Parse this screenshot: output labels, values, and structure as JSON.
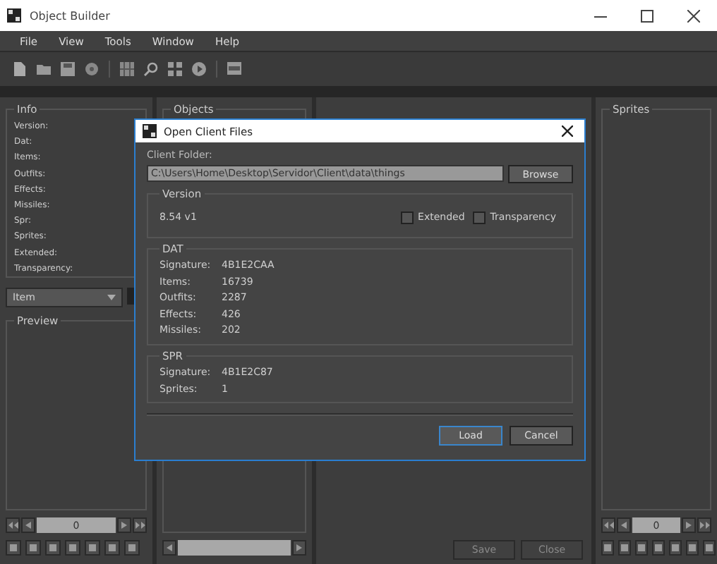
{
  "window": {
    "title": "Object Builder"
  },
  "menu": [
    "File",
    "View",
    "Tools",
    "Window",
    "Help"
  ],
  "info": {
    "title": "Info",
    "fields": [
      "Version:",
      "Dat:",
      "Items:",
      "Outfits:",
      "Effects:",
      "Missiles:",
      "Spr:",
      "Sprites:",
      "Extended:",
      "Transparency:"
    ]
  },
  "category": {
    "value": "Item"
  },
  "preview": {
    "title": "Preview",
    "frame": "0"
  },
  "objects": {
    "title": "Objects"
  },
  "center_buttons": [
    {
      "label": "Save",
      "disabled": true
    },
    {
      "label": "Close",
      "disabled": true
    }
  ],
  "sprites": {
    "title": "Sprites",
    "frame": "0"
  },
  "dialog": {
    "title": "Open Client Files",
    "folder_label": "Client Folder:",
    "folder": "C:\\Users\\Home\\Desktop\\Servidor\\Client\\data\\things",
    "browse": "Browse",
    "version": {
      "title": "Version",
      "value": "8.54 v1",
      "options": [
        {
          "label": "Extended",
          "checked": false
        },
        {
          "label": "Transparency",
          "checked": false
        }
      ]
    },
    "dat": {
      "title": "DAT",
      "rows": [
        {
          "label": "Signature:",
          "value": "4B1E2CAA"
        },
        {
          "label": "Items:",
          "value": "16739"
        },
        {
          "label": "Outfits:",
          "value": "2287"
        },
        {
          "label": "Effects:",
          "value": "426"
        },
        {
          "label": "Missiles:",
          "value": "202"
        }
      ]
    },
    "spr": {
      "title": "SPR",
      "rows": [
        {
          "label": "Signature:",
          "value": "4B1E2C87"
        },
        {
          "label": "Sprites:",
          "value": "1"
        }
      ]
    },
    "buttons": [
      {
        "label": "Load",
        "default": true
      },
      {
        "label": "Cancel",
        "default": false
      }
    ]
  }
}
